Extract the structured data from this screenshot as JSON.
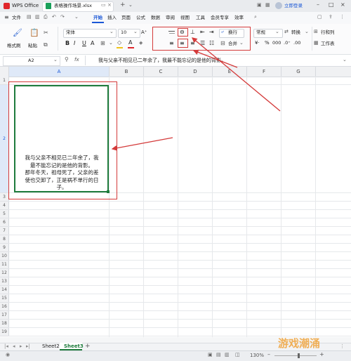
{
  "titlebar": {
    "app_name": "WPS Office",
    "doc_name": "表格操作场景.xlsx",
    "login": "立即登录"
  },
  "menu": {
    "file": "文件",
    "items": [
      "开始",
      "插入",
      "页面",
      "公式",
      "数据",
      "审阅",
      "视图",
      "工具",
      "会员专享",
      "效率"
    ],
    "active_index": 0
  },
  "ribbon": {
    "format_painter": "格式刷",
    "paste": "粘贴",
    "font_name": "宋体",
    "font_size": "10",
    "wrap": "换行",
    "merge": "合并",
    "number_format": "常规",
    "convert": "转换",
    "row_col": "行和列",
    "worksheet": "工作表"
  },
  "formula_bar": {
    "cell_ref": "A2",
    "fx": "fx",
    "content": "我与父亲不相见已二年余了，我最不能忘记的是他的背影。"
  },
  "grid": {
    "columns": [
      "A",
      "B",
      "C",
      "D",
      "E",
      "F",
      "G"
    ],
    "rows": [
      "1",
      "2",
      "3",
      "4",
      "5",
      "6",
      "7",
      "8",
      "9",
      "10",
      "11",
      "12",
      "13",
      "14",
      "15",
      "16",
      "17",
      "18",
      "19",
      "20",
      "21",
      "22",
      "23",
      "24",
      "25",
      "26",
      "27",
      "28"
    ],
    "a2_lines": [
      "我与父亲不相见已二年余了，我",
      "最不能忘记的是他的背影。",
      "那年冬天，祖母死了，父亲的差",
      "使也交卸了，正是祸不单行的日",
      "子。"
    ]
  },
  "sheets": {
    "tabs": [
      "Sheet2",
      "Sheet3"
    ],
    "active_index": 1,
    "add": "+"
  },
  "status": {
    "zoom": "130%"
  },
  "watermark": "游戏潮涌",
  "colors": {
    "accent": "#1a57d6",
    "annotation_red": "#d43a3a",
    "selection_green": "#1e7b3c"
  }
}
